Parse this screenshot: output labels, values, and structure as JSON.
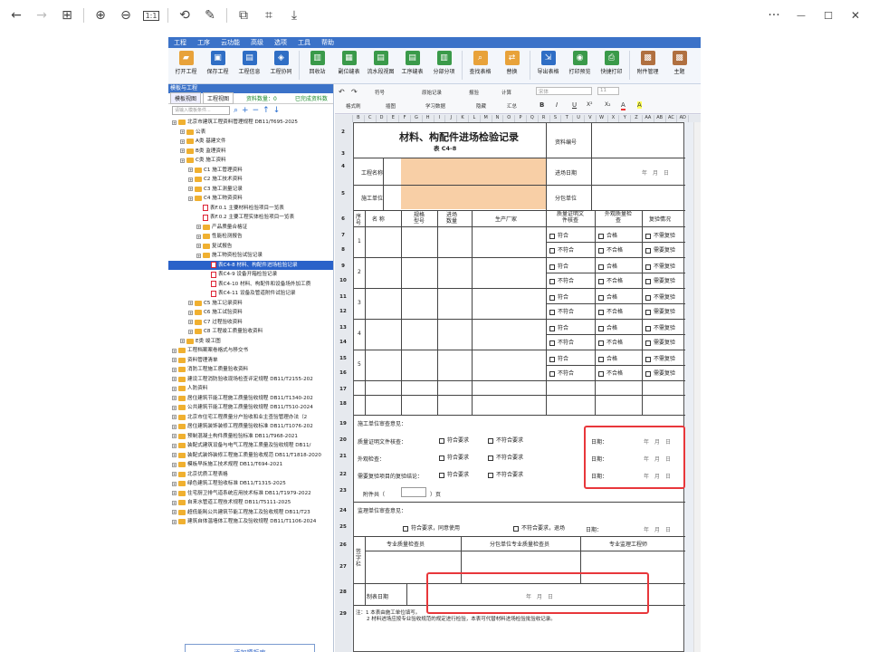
{
  "viewer": {
    "toolbar_icons": [
      "back-arrow-icon",
      "forward-arrow-icon",
      "grid-icon",
      "zoom-in-icon",
      "zoom-out-icon",
      "actual-size-icon",
      "rotate-icon",
      "edit-icon",
      "crop-icon",
      "ocr-icon",
      "download-icon"
    ],
    "actual_size_label": "1:1",
    "more": "···",
    "minimize": "—",
    "maximize": "☐",
    "close": "✕"
  },
  "app": {
    "menu": [
      "工程",
      "工序",
      "云功能",
      "高级",
      "选项",
      "工具",
      "帮助"
    ],
    "ribbon": [
      {
        "label": "打开工程",
        "color": "#e8a23a"
      },
      {
        "label": "保存工程",
        "color": "#2f6ec5"
      },
      {
        "label": "工程信息",
        "color": "#2f6ec5"
      },
      {
        "label": "工程协同",
        "color": "#2f6ec5"
      },
      {
        "label": "回收站",
        "color": "#3a9a4a"
      },
      {
        "label": "副位缝表",
        "color": "#3a9a4a"
      },
      {
        "label": "流水段视图",
        "color": "#3a9a4a"
      },
      {
        "label": "工序缝表",
        "color": "#3a9a4a"
      },
      {
        "label": "分部分项",
        "color": "#3a9a4a"
      },
      {
        "label": "查找表格",
        "color": "#e8a23a"
      },
      {
        "label": "替换",
        "color": "#e8a23a"
      },
      {
        "label": "导出表格",
        "color": "#2f6ec5"
      },
      {
        "label": "打印预览",
        "color": "#3a9a4a"
      },
      {
        "label": "快捷打印",
        "color": "#3a9a4a"
      },
      {
        "label": "附件管理",
        "color": "#b07040"
      },
      {
        "label": "主题",
        "color": "#b07040"
      }
    ],
    "left_panel": {
      "title": "模板与工程",
      "tabs": [
        "模板视图",
        "工程视图"
      ],
      "count_label": "资料数量：0",
      "done_label": "已完成资料数",
      "search_placeholder": "请输入模板条件...",
      "add_button": "添加模板库",
      "tree": [
        {
          "l": 0,
          "t": "北京市建筑工程资料管理规程 DB11/T695-2025",
          "k": "fd"
        },
        {
          "l": 1,
          "t": "公表",
          "k": "fd"
        },
        {
          "l": 1,
          "t": "A类 基建文件",
          "k": "fd"
        },
        {
          "l": 1,
          "t": "B类 监理资料",
          "k": "fd"
        },
        {
          "l": 1,
          "t": "C类 施工资料",
          "k": "fd"
        },
        {
          "l": 2,
          "t": "C1 施工管理资料",
          "k": "fd"
        },
        {
          "l": 2,
          "t": "C2 施工技术资料",
          "k": "fd"
        },
        {
          "l": 2,
          "t": "C3 施工测量记录",
          "k": "fd"
        },
        {
          "l": 2,
          "t": "C4 施工物资资料",
          "k": "fd"
        },
        {
          "l": 3,
          "t": "表F.0.1 主要材料检验项目一览表",
          "k": "pdf"
        },
        {
          "l": 3,
          "t": "表F.0.2 主要工程实体检验项目一览表",
          "k": "pdf"
        },
        {
          "l": 3,
          "t": "产品质量合格证",
          "k": "fd"
        },
        {
          "l": 3,
          "t": "性能检测报告",
          "k": "fd"
        },
        {
          "l": 3,
          "t": "复试报告",
          "k": "fd"
        },
        {
          "l": 3,
          "t": "施工物资检验试验记录",
          "k": "fd"
        },
        {
          "l": 4,
          "t": "表C4-8 材料、构配件进场检验记录",
          "k": "pdf",
          "sel": true
        },
        {
          "l": 4,
          "t": "表C4-9 设备开箱检验记录",
          "k": "pdf"
        },
        {
          "l": 4,
          "t": "表C4-10 材料、构配件和设备场外加工质",
          "k": "pdf"
        },
        {
          "l": 4,
          "t": "表C4-11 设备及管道附件试验记录",
          "k": "pdf"
        },
        {
          "l": 2,
          "t": "C5 施工记录资料",
          "k": "fd"
        },
        {
          "l": 2,
          "t": "C6 施工试验资料",
          "k": "fd"
        },
        {
          "l": 2,
          "t": "C7 过程验收资料",
          "k": "fd"
        },
        {
          "l": 2,
          "t": "C8 工程竣工质量验收资料",
          "k": "fd"
        },
        {
          "l": 1,
          "t": "E类 竣工图",
          "k": "fd"
        },
        {
          "l": 0,
          "t": "工程档案案卷格式与移交书",
          "k": "fd"
        },
        {
          "l": 0,
          "t": "资料管理清单",
          "k": "fd"
        },
        {
          "l": 0,
          "t": "消防工程施工质量验收资料",
          "k": "fd"
        },
        {
          "l": 0,
          "t": "建设工程消防验收现场检查评定规程 DB11/T2155-202",
          "k": "fd"
        },
        {
          "l": 0,
          "t": "人防资料",
          "k": "fd"
        },
        {
          "l": 0,
          "t": "居住建筑节能工程施工质量验收规程 DB11/T1340-202",
          "k": "fd"
        },
        {
          "l": 0,
          "t": "公共建筑节能工程施工质量验收规程 DB11/T510-2024",
          "k": "fd"
        },
        {
          "l": 0,
          "t": "北京市住宅工程质量分户验收和业主查验管理办法（2",
          "k": "fd"
        },
        {
          "l": 0,
          "t": "居住建筑装饰装修工程质量验收标准 DB11/T1076-202",
          "k": "fd"
        },
        {
          "l": 0,
          "t": "预制混凝土构件质量检验标准 DB11/T968-2021",
          "k": "fd"
        },
        {
          "l": 0,
          "t": "装配式建筑设备与电气工程施工质量及验收规程 DB11/",
          "k": "fd"
        },
        {
          "l": 0,
          "t": "装配式装饰装修工程施工质量验收规范 DB11/T1818-2020",
          "k": "fd"
        },
        {
          "l": 0,
          "t": "模板早拆施工技术规程 DB11/T694-2021",
          "k": "fd"
        },
        {
          "l": 0,
          "t": "北京优质工程表格",
          "k": "fd"
        },
        {
          "l": 0,
          "t": "绿色建筑工程验收标准 DB11/T1315-2025",
          "k": "fd"
        },
        {
          "l": 0,
          "t": "住宅厨卫排气道系统应用技术标准 DB11/T1979-2022",
          "k": "fd"
        },
        {
          "l": 0,
          "t": "自来水管道工程技术规程 DB11/T5111-2025",
          "k": "fd"
        },
        {
          "l": 0,
          "t": "超低能耗公共建筑节能工程施工及验收规程 DB11/T23",
          "k": "fd"
        },
        {
          "l": 0,
          "t": "建筑自体温墙体工程施工及验收规程 DB11/T1106-2024",
          "k": "fd"
        }
      ]
    },
    "format_bar": {
      "undo": "↶",
      "redo": "↷",
      "row1": [
        "符号",
        "原始记录",
        "报验",
        "计算",
        "宋体",
        "11"
      ],
      "row2": [
        "格式刷",
        "插图",
        "学习数据",
        "隐藏",
        "汇总"
      ],
      "text_btns": [
        "B",
        "I",
        "U",
        "X²",
        "X₂",
        "A",
        "A"
      ]
    },
    "columns": [
      "B",
      "C",
      "D",
      "E",
      "F",
      "G",
      "H",
      "I",
      "J",
      "K",
      "L",
      "M",
      "N",
      "O",
      "P",
      "Q",
      "R",
      "S",
      "T",
      "U",
      "V",
      "W",
      "X",
      "Y",
      "Z",
      "AA",
      "AB",
      "AC",
      "AD"
    ],
    "form": {
      "title": "材料、构配件进场检验记录",
      "subtitle": "表 C4-8",
      "material_no": "资料编号",
      "project_name": "工程名称",
      "entry_date": "进场日期",
      "date_fmt": "年　月　日",
      "construction_unit": "施工单位",
      "sub_unit": "分包单位",
      "h_seq": "序号",
      "h_name": "名 称",
      "h_spec": "规格型号",
      "h_qty": "进场数量",
      "h_mfr": "生产厂家",
      "h_cert": "质量证明文件核查",
      "h_appearance": "外观质量检查",
      "h_recheck": "复验情况",
      "seq": [
        "1",
        "2",
        "3",
        "4",
        "5"
      ],
      "ok": "符合",
      "nok": "不符合",
      "pass": "合格",
      "fail": "不合格",
      "no_need": "不需复验",
      "need": "需要复验",
      "r19": "施工单位审查意见：",
      "r20": "质量证明文件核查：",
      "r21": "外观检查：",
      "r22": "需要复验项目的复验结论：",
      "meet": "符合要求",
      "not_meet": "不符合要求",
      "date_label": "日期：",
      "attach": "附件共（",
      "attach_end": "）页",
      "r24": "监理单位审查意见：",
      "accept": "符合要求，同意使用",
      "reject": "不符合要求，退场",
      "date2": "日期：",
      "sign": "签字栏",
      "qc": "专业质量检查员",
      "sub_qc": "分包单位专业质量检查员",
      "supervisor": "专业监理工程师",
      "made_date": "制表日期",
      "note1": "注：1 本表由施工单位填写。",
      "note2": "2 材料进场应按专业验收规范的规定进行检验，本表可代替材料进场检验批验收记录。"
    },
    "rows": [
      "2",
      "3",
      "4",
      "5",
      "6",
      "7",
      "8",
      "9",
      "10",
      "11",
      "12",
      "13",
      "14",
      "15",
      "16",
      "17",
      "18",
      "19",
      "20",
      "21",
      "22",
      "23",
      "24",
      "25",
      "26",
      "27",
      "28",
      "29"
    ]
  }
}
